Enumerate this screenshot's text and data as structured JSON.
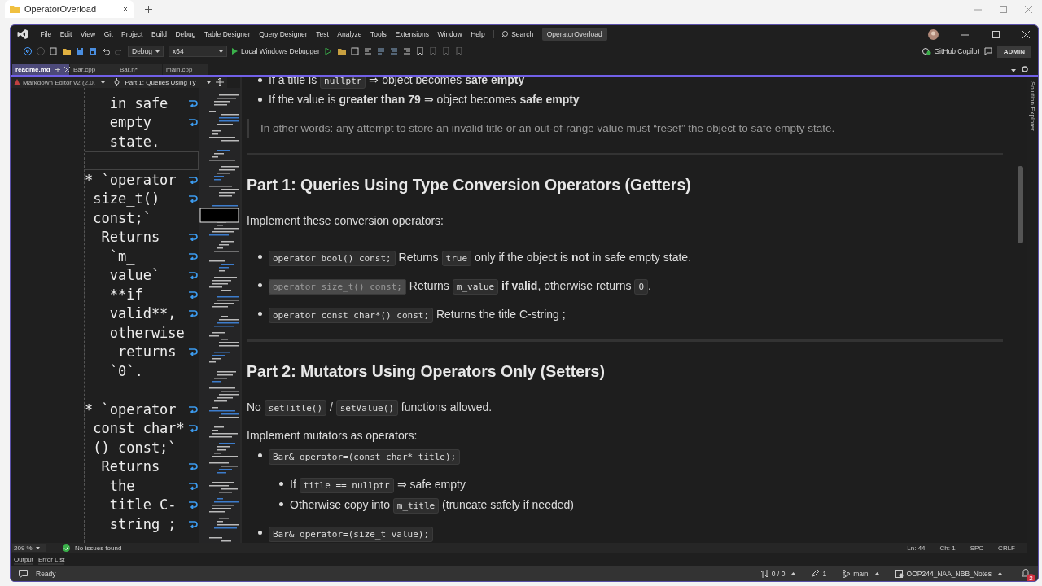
{
  "browser": {
    "tab": {
      "title": "OperatorOverload"
    }
  },
  "ide": {
    "menu": [
      "File",
      "Edit",
      "View",
      "Git",
      "Project",
      "Build",
      "Debug",
      "Table Designer",
      "Query Designer",
      "Test",
      "Analyze",
      "Tools",
      "Extensions",
      "Window",
      "Help"
    ],
    "search": "Search",
    "solution_title": "OperatorOverload",
    "toolbar": {
      "configuration": "Debug",
      "platform": "x64",
      "run": "Local Windows Debugger",
      "copilot": "GitHub Copilot",
      "account": "ADMIN"
    },
    "document_tabs": [
      {
        "label": "readme.md",
        "selected": true
      },
      {
        "label": "Bar.cpp",
        "selected": false
      },
      {
        "label": "Bar.h*",
        "selected": false
      },
      {
        "label": "main.cpp",
        "selected": false
      }
    ],
    "editor_bar": {
      "editor": "Markdown Editor v2 (2.0.",
      "section": "Part 1: Queries Using Ty"
    },
    "side_tab": "Solution Explorer",
    "source_lines": [
      {
        "text": "   in safe",
        "wrap": true
      },
      {
        "text": "   empty",
        "wrap": true
      },
      {
        "text": "   state.",
        "wrap": false
      },
      {
        "kind": "blank",
        "current": true
      },
      {
        "text": "* `operator",
        "wrap": true
      },
      {
        "text": " size_t()",
        "wrap": true
      },
      {
        "text": " const;`",
        "wrap": false
      },
      {
        "text": "  Returns",
        "wrap": true
      },
      {
        "text": "   `m_",
        "wrap": true
      },
      {
        "text": "   value`",
        "wrap": true
      },
      {
        "text": "   **if",
        "wrap": true
      },
      {
        "text": "   valid**,",
        "wrap": true
      },
      {
        "text": "   otherwise",
        "wrap": false
      },
      {
        "text": "    returns",
        "wrap": true
      },
      {
        "text": "   `0`.",
        "wrap": false
      },
      {
        "kind": "blank"
      },
      {
        "text": "* `operator",
        "wrap": true
      },
      {
        "text": " const char*",
        "wrap": true
      },
      {
        "text": " () const;`",
        "wrap": false
      },
      {
        "text": "  Returns",
        "wrap": true
      },
      {
        "text": "   the",
        "wrap": true
      },
      {
        "text": "   title C-",
        "wrap": true
      },
      {
        "text": "   string ;",
        "wrap": true
      }
    ],
    "preview": [
      {
        "kind": "bullets",
        "items": [
          {
            "parts": [
              {
                "kind": "text",
                "text": "If a title is "
              },
              {
                "kind": "code",
                "text": "nullptr"
              },
              {
                "kind": "text",
                "text": " ⇒ object becomes **safe empty**"
              }
            ]
          },
          {
            "parts": [
              {
                "kind": "text",
                "text": "If the value is **greater than 79** ⇒ object becomes **safe empty**"
              }
            ]
          }
        ]
      },
      {
        "kind": "quote",
        "text": "In other words: any attempt to store an invalid title or an out-of-range value must “reset” the object to safe empty state."
      },
      {
        "kind": "rule"
      },
      {
        "kind": "heading",
        "text": "Part 1: Queries Using Type Conversion Operators (Getters)"
      },
      {
        "kind": "paragraph",
        "parts": [
          {
            "kind": "text",
            "text": "Implement these conversion operators:"
          }
        ]
      },
      {
        "kind": "bullets",
        "items": [
          {
            "parts": [
              {
                "kind": "code",
                "text": "operator bool() const;"
              },
              {
                "kind": "text",
                "text": " Returns "
              },
              {
                "kind": "code",
                "text": "true"
              },
              {
                "kind": "text",
                "text": " only if the object is **not** in safe empty state."
              }
            ]
          },
          {
            "parts": [
              {
                "kind": "code",
                "text": "operator size_t() const;",
                "highlighted": true
              },
              {
                "kind": "text",
                "text": " Returns "
              },
              {
                "kind": "code",
                "text": "m_value"
              },
              {
                "kind": "text",
                "text": " **if valid**, otherwise returns "
              },
              {
                "kind": "code",
                "text": "0"
              },
              {
                "kind": "text",
                "text": "."
              }
            ]
          },
          {
            "parts": [
              {
                "kind": "code",
                "text": "operator const char*() const;"
              },
              {
                "kind": "text",
                "text": " Returns the title C-string ;"
              }
            ]
          }
        ]
      },
      {
        "kind": "rule"
      },
      {
        "kind": "heading",
        "text": "Part 2: Mutators Using Operators Only (Setters)"
      },
      {
        "kind": "paragraph",
        "parts": [
          {
            "kind": "text",
            "text": "No "
          },
          {
            "kind": "code",
            "text": "setTitle()"
          },
          {
            "kind": "text",
            "text": " / "
          },
          {
            "kind": "code",
            "text": "setValue()"
          },
          {
            "kind": "text",
            "text": " functions allowed."
          }
        ]
      },
      {
        "kind": "paragraph",
        "parts": [
          {
            "kind": "text",
            "text": "Implement mutators as operators:"
          }
        ]
      },
      {
        "kind": "bullets",
        "items": [
          {
            "parts": [
              {
                "kind": "code",
                "text": "Bar& operator=(const char* title);"
              }
            ],
            "children": [
              {
                "parts": [
                  {
                    "kind": "text",
                    "text": "If "
                  },
                  {
                    "kind": "code",
                    "text": "title == nullptr"
                  },
                  {
                    "kind": "text",
                    "text": " ⇒ safe empty"
                  }
                ]
              },
              {
                "parts": [
                  {
                    "kind": "text",
                    "text": "Otherwise copy into "
                  },
                  {
                    "kind": "code",
                    "text": "m_title"
                  },
                  {
                    "kind": "text",
                    "text": " (truncate safely if needed)"
                  }
                ]
              }
            ]
          },
          {
            "parts": [
              {
                "kind": "code",
                "text": "Bar& operator=(size_t value);"
              }
            ]
          }
        ]
      }
    ],
    "editor_status": {
      "zoom": "209 %",
      "issues": "No issues found",
      "line": "Ln: 44",
      "column": "Ch: 1",
      "indent": "SPC",
      "line_ending": "CRLF"
    },
    "tool_tabs": [
      "Output",
      "Error List"
    ],
    "status_bar": {
      "state": "Ready",
      "changes": "0 / 0",
      "edits": "1",
      "branch": "main",
      "repository": "OOP244_NAA_NBB_Notes",
      "notifications": "2"
    }
  }
}
